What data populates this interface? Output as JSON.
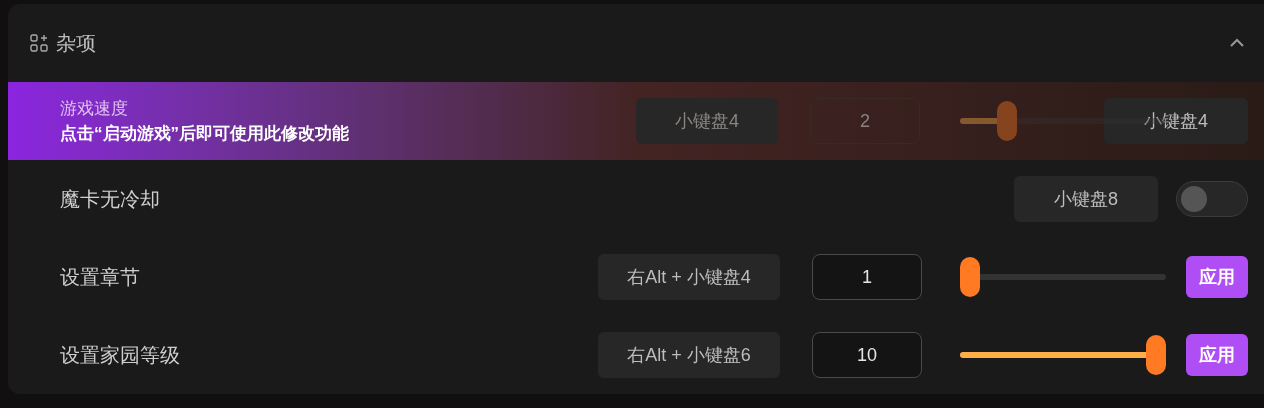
{
  "section": {
    "title": "杂项",
    "expanded": true
  },
  "rows": [
    {
      "kind": "notice",
      "label": "游戏速度",
      "notice": "点击“启动游戏”后即可使用此修改功能",
      "hotkey": "小键盘4",
      "value": "2",
      "level": 0.2,
      "button": "小键盘4"
    },
    {
      "kind": "toggle",
      "label": "魔卡无冷却",
      "hotkey": "小键盘8",
      "on": false
    },
    {
      "kind": "slider",
      "label": "设置章节",
      "hotkey": "右Alt + 小键盘4",
      "value": "1",
      "level": 0,
      "button": "应用"
    },
    {
      "kind": "slider",
      "label": "设置家园等级",
      "hotkey": "右Alt + 小键盘6",
      "value": "10",
      "level": 1,
      "button": "应用"
    }
  ]
}
